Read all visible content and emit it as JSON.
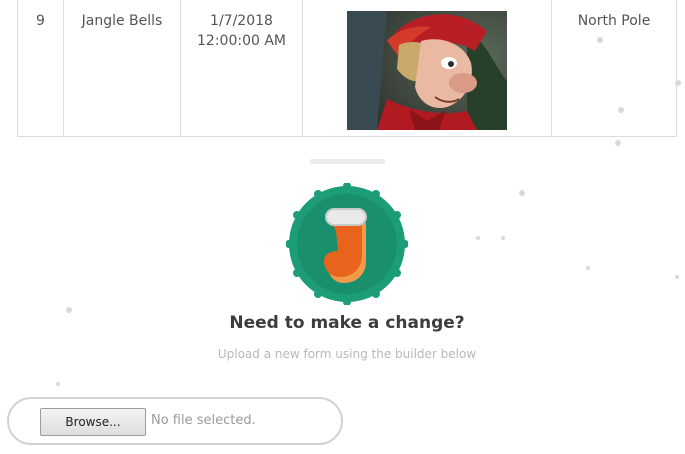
{
  "table": {
    "row": {
      "number": "9",
      "name": "Jangle Bells",
      "date_line1": "1/7/2018",
      "date_line2": "12:00:00 AM",
      "location": "North Pole"
    }
  },
  "badge": {
    "icon": "stocking-icon",
    "colors": {
      "wreath": "#1c9d78",
      "stocking": "#e8641c",
      "cuff": "#e9e9e9"
    }
  },
  "change_section": {
    "heading": "Need to make a change?",
    "subtext": "Upload a new form using the builder below"
  },
  "file_input": {
    "button_label": "Browse...",
    "status": "No file selected."
  }
}
